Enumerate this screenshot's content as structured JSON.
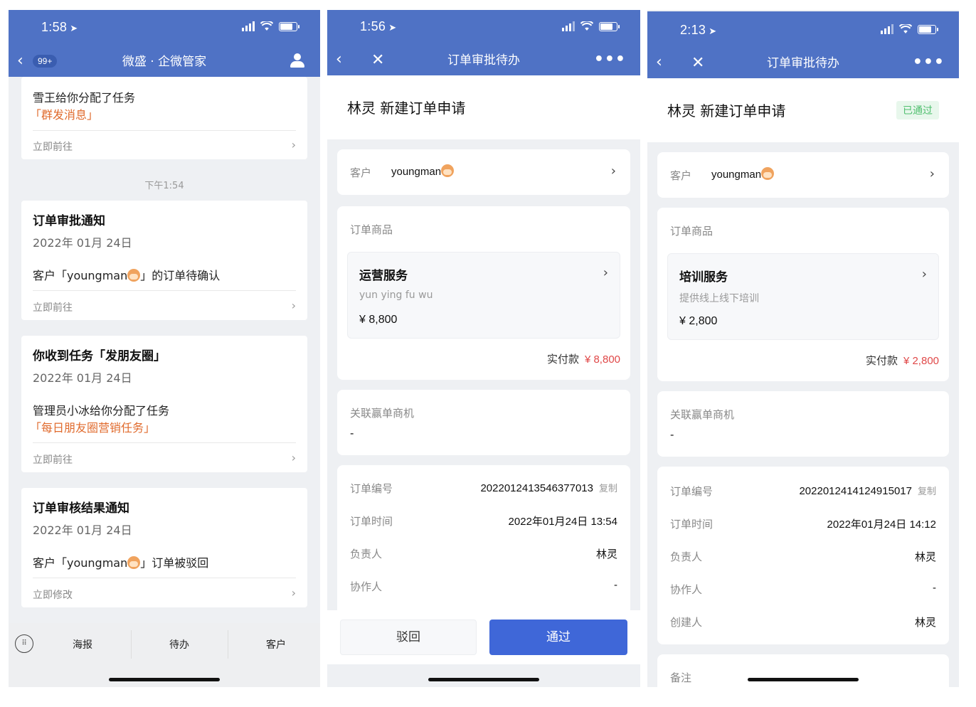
{
  "panel1": {
    "status": {
      "time": "1:58"
    },
    "nav": {
      "back_badge": "99+",
      "title": "微盛 · 企微管家"
    },
    "card0": {
      "line1": "雪王给你分配了任务",
      "highlight": "「群发消息」",
      "action": "立即前往"
    },
    "center_time": "下午1:54",
    "card1": {
      "title": "订单审批通知",
      "date": "2022年 01月 24日",
      "body_pre": "客户「youngman",
      "body_post": "」的订单待确认",
      "action": "立即前往"
    },
    "card2": {
      "title": "你收到任务「发朋友圈」",
      "date": "2022年 01月 24日",
      "body": "管理员小冰给你分配了任务",
      "highlight": "「每日朋友圈营销任务」",
      "action": "立即前往"
    },
    "card3": {
      "title": "订单审核结果通知",
      "date": "2022年 01月 24日",
      "body_pre": "客户「youngman",
      "body_post": "」订单被驳回",
      "action": "立即修改"
    },
    "tabbar": {
      "tabs": [
        "海报",
        "待办",
        "客户"
      ]
    }
  },
  "panel2": {
    "status": {
      "time": "1:56"
    },
    "nav": {
      "title": "订单审批待办"
    },
    "header": {
      "name": "林灵 新建订单申请"
    },
    "customer": {
      "label": "客户",
      "value": "youngman"
    },
    "goods": {
      "label": "订单商品",
      "product_name": "运营服务",
      "product_desc": "yun ying fu wu",
      "product_price": "¥ 8,800",
      "paid_label": "实付款",
      "paid_amount": "¥ 8,800"
    },
    "opportunity": {
      "label": "关联赢单商机",
      "value": "-"
    },
    "details": {
      "order_no_label": "订单编号",
      "order_no": "2022012413546377013",
      "copy": "复制",
      "time_label": "订单时间",
      "time_value": "2022年01月24日 13:54",
      "owner_label": "负责人",
      "owner_value": "林灵",
      "collab_label": "协作人",
      "collab_value": "-"
    },
    "actions": {
      "reject": "驳回",
      "approve": "通过"
    }
  },
  "panel3": {
    "status": {
      "time": "2:13"
    },
    "nav": {
      "title": "订单审批待办"
    },
    "header": {
      "name": "林灵 新建订单申请",
      "status": "已通过"
    },
    "customer": {
      "label": "客户",
      "value": "youngman"
    },
    "goods": {
      "label": "订单商品",
      "product_name": "培训服务",
      "product_desc": "提供线上线下培训",
      "product_price": "¥ 2,800",
      "paid_label": "实付款",
      "paid_amount": "¥ 2,800"
    },
    "opportunity": {
      "label": "关联赢单商机",
      "value": "-"
    },
    "details": {
      "order_no_label": "订单编号",
      "order_no": "2022012414124915017",
      "copy": "复制",
      "time_label": "订单时间",
      "time_value": "2022年01月24日 14:12",
      "owner_label": "负责人",
      "owner_value": "林灵",
      "collab_label": "协作人",
      "collab_value": "-",
      "creator_label": "创建人",
      "creator_value": "林灵"
    },
    "remark": {
      "label": "备注"
    }
  },
  "colors": {
    "nav_blue": "#4f72c5",
    "approve_blue": "#3f67d8",
    "orange": "#e06a2c",
    "red": "#e04848",
    "green": "#4fbf6e"
  }
}
